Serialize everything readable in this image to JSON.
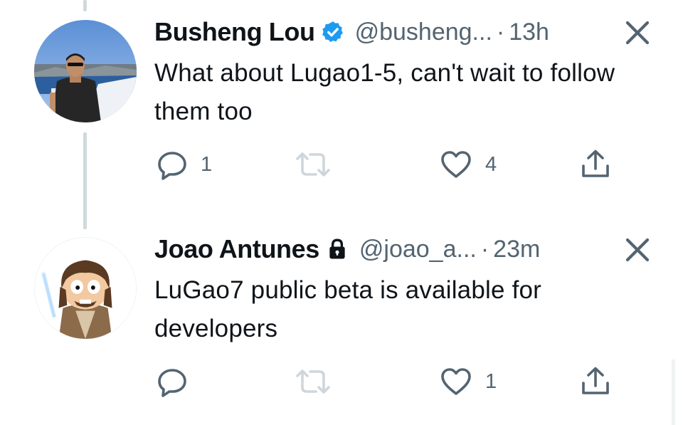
{
  "tweets": [
    {
      "author_name": "Busheng Lou",
      "badge": "verified-badge",
      "handle": "@busheng...",
      "separator": "·",
      "time": "13h",
      "text": "What about Lugao1-5, can't wait to follow them too",
      "reply_count": "1",
      "retweet_count": "",
      "like_count": "4"
    },
    {
      "author_name": "Joao Antunes",
      "badge": "lock-icon",
      "handle": "@joao_a...",
      "separator": "·",
      "time": "23m",
      "text": "LuGao7 public beta is available for developers",
      "reply_count": "",
      "retweet_count": "",
      "like_count": "1"
    }
  ],
  "colors": {
    "text": "#0f1419",
    "secondary": "#536471",
    "verified": "#1d9bf0",
    "thread_line": "#cfd9de"
  },
  "icons": [
    "reply-icon",
    "retweet-icon",
    "like-icon",
    "share-icon",
    "close-icon",
    "verified-badge",
    "lock-icon"
  ]
}
